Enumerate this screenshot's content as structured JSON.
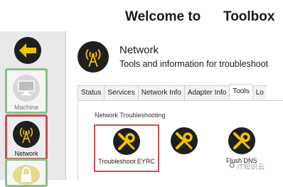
{
  "header": {
    "title_left": "Welcome to",
    "title_right": "Toolbox"
  },
  "sidebar": {
    "back_icon": "arrow-left-icon",
    "items": [
      {
        "label": "Machine",
        "icon": "monitor-icon"
      },
      {
        "label": "Network",
        "icon": "antenna-icon",
        "selected": true
      },
      {
        "label": "",
        "icon": "lock-icon"
      }
    ]
  },
  "main": {
    "title": "Network",
    "subtitle": "Tools and information for troubleshoot",
    "tabs": [
      "Status",
      "Services",
      "Network Info",
      "Adapter Info",
      "Tools",
      "Lo"
    ],
    "active_tab": "Tools",
    "section_label": "Network Troubleshooting",
    "tools": [
      {
        "label": "Troubleshoot EYRC",
        "icon": "wrench-screwdriver-icon",
        "highlighted": true
      },
      {
        "label": "",
        "icon": "wrench-screwdriver-icon"
      },
      {
        "label": "Flush DNS",
        "icon": "wrench-screwdriver-icon"
      }
    ]
  },
  "watermark": {
    "text": "IT知识云"
  },
  "colors": {
    "highlight_red": "#c85050",
    "tile_green": "#8cbf8c",
    "icon_yellow": "#f2c200"
  }
}
